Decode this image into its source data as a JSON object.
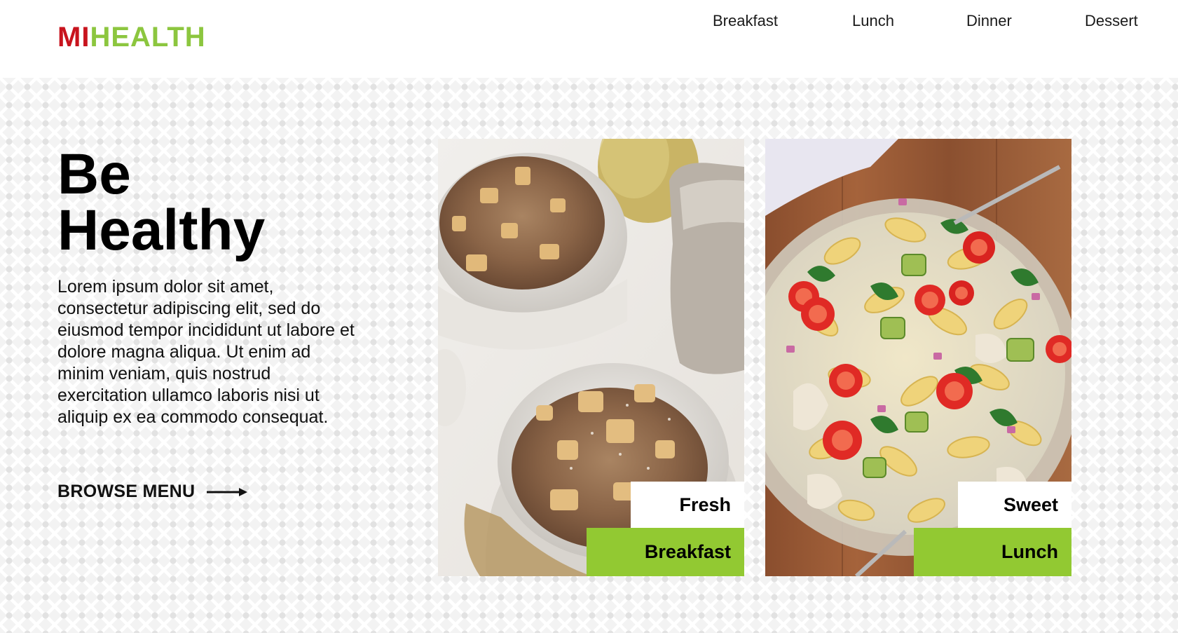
{
  "brand": {
    "part1": "MI",
    "part2": "HEALTH",
    "color_part1": "#c8141e",
    "color_part2": "#8cc63f"
  },
  "nav": {
    "items": [
      "Breakfast",
      "Lunch",
      "Dinner",
      "Dessert"
    ]
  },
  "hero": {
    "title_line1": "Be",
    "title_line2": "Healthy",
    "description": "Lorem ipsum dolor sit amet, consectetur adipiscing elit, sed do eiusmod tempor incididunt ut labore et dolore magna aliqua. Ut enim ad minim veniam, quis nostrud exercitation ullamco laboris nisi ut aliquip ex ea commodo consequat.",
    "cta_label": "BROWSE MENU",
    "cta_icon": "arrow-right-icon"
  },
  "cards": [
    {
      "image": "oatmeal-apple-bowls-photo",
      "tag": "Fresh",
      "category": "Breakfast"
    },
    {
      "image": "pasta-salad-bowl-photo",
      "tag": "Sweet",
      "category": "Lunch"
    }
  ],
  "colors": {
    "accent_green": "#92c932",
    "text": "#111111"
  }
}
